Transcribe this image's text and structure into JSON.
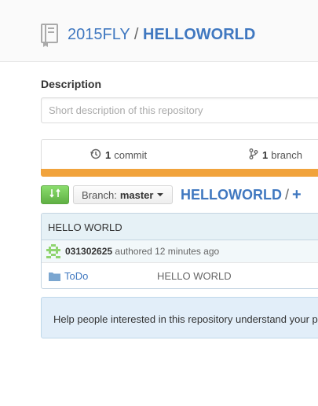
{
  "header": {
    "owner": "2015FLY",
    "separator": "/",
    "repo": "HELLOWORLD"
  },
  "description": {
    "label": "Description",
    "placeholder": "Short description of this repository"
  },
  "summary": {
    "commits_count": "1",
    "commits_label": "commit",
    "branches_count": "1",
    "branches_label": "branch"
  },
  "file_nav": {
    "branch_label": "Branch:",
    "branch_value": "master",
    "root": "HELLOWORLD",
    "slash": "/",
    "plus": "+"
  },
  "latest_commit": {
    "message": "HELLO WORLD",
    "author": "031302625",
    "authored_text": "authored 12 minutes ago"
  },
  "files": [
    {
      "name": "ToDo",
      "message": "HELLO WORLD"
    }
  ],
  "readme_prompt": "Help people interested in this repository understand your project",
  "colors": {
    "link": "#4078c0",
    "language_bar": "#f1a33c",
    "compare_button": "#60b044"
  }
}
